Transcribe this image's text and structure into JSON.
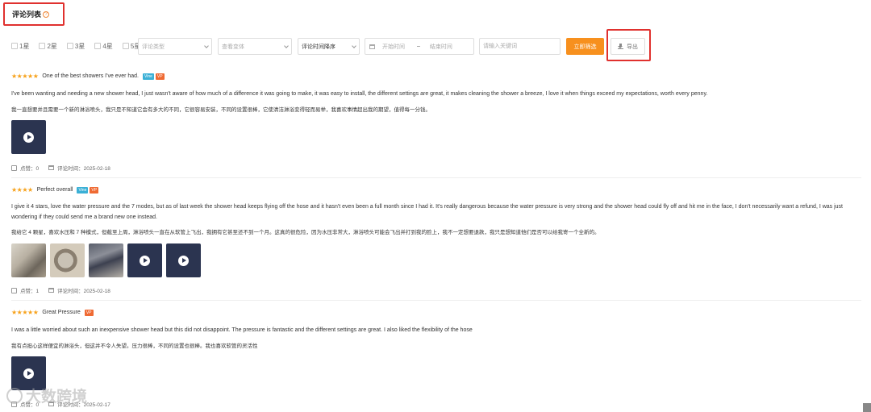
{
  "header": {
    "title": "评论列表",
    "help_icon": "question-circle-icon"
  },
  "filters": {
    "star_options": [
      "1星",
      "2星",
      "3星",
      "4星",
      "5星"
    ],
    "review_type_placeholder": "评论类型",
    "variant_placeholder": "查看变体",
    "sort_value": "评论时间降序",
    "start_date_placeholder": "开始时间",
    "date_separator": "–",
    "end_date_placeholder": "结束时间",
    "keyword_placeholder": "请输入关键词",
    "search_label": "立即筛选",
    "export_label": "导出"
  },
  "reviews": [
    {
      "stars": "★★★★★",
      "title": "One of the best showers I've ever had.",
      "badges": [
        "Vine",
        "VP"
      ],
      "text_en": "I've been wanting and needing a new shower head, I just wasn't aware of how much of a difference it was going to make, it was easy to install, the different settings are great, it makes cleaning the shower a breeze, I love it when things exceed my expectations, worth every penny.",
      "text_zh": "我一直想要并且需要一个新的淋浴喷头，我只是不知道它会有多大的不同，它很容易安装，不同的设置很棒，它使清洁淋浴变得轻而易举，我喜欢事情超出我的期望，值得每一分钱。",
      "media": [
        "video"
      ],
      "likes": "点赞：0",
      "date": "评论时间：2025-02-18"
    },
    {
      "stars": "★★★★",
      "title": "Perfect overall",
      "badges": [
        "Vine",
        "VP"
      ],
      "text_en": "I give it 4 stars, love the water pressure and the 7 modes, but as of last week the shower head keeps flying off the hose and it hasn't even been a full month since I had it. It's really dangerous because the water pressure is very strong and the shower head could fly off and hit me in the face, I don't necessarily want a refund, I was just wondering if they could send me a brand new one instead.",
      "text_zh": "我给它 4 颗星，喜欢水压和 7 种模式，但截至上周，淋浴喷头一直在从软管上飞出，我拥有它甚至还不到一个月。这真的很危险，因为水压非常大，淋浴喷头可能会飞出并打到我的脸上，我不一定想要退款，我只是想知道他们是否可以给我寄一个全新的。",
      "media": [
        "photo1",
        "photo2",
        "photo3",
        "video",
        "video"
      ],
      "likes": "点赞：1",
      "date": "评论时间：2025-02-18"
    },
    {
      "stars": "★★★★★",
      "title": "Great Pressure",
      "badges": [
        "VP"
      ],
      "text_en": "I was a little worried about such an inexpensive shower head but this did not disappoint. The pressure is fantastic and the different settings are great. I also liked the flexibility of the hose",
      "text_zh": "我有点担心这样便宜的淋浴头，但这并不令人失望。压力很棒，不同的设置也很棒。我也喜欢软管的灵活性",
      "media": [
        "video"
      ],
      "likes": "点赞：0",
      "date": "评论时间：2025-02-17"
    }
  ],
  "watermark": "大数跨境",
  "colors": {
    "accent": "#f7901e",
    "highlight_border": "#e0312e",
    "star": "#f7a21b",
    "vine_badge": "#3bb0d6",
    "vp_badge": "#ef6a33"
  }
}
